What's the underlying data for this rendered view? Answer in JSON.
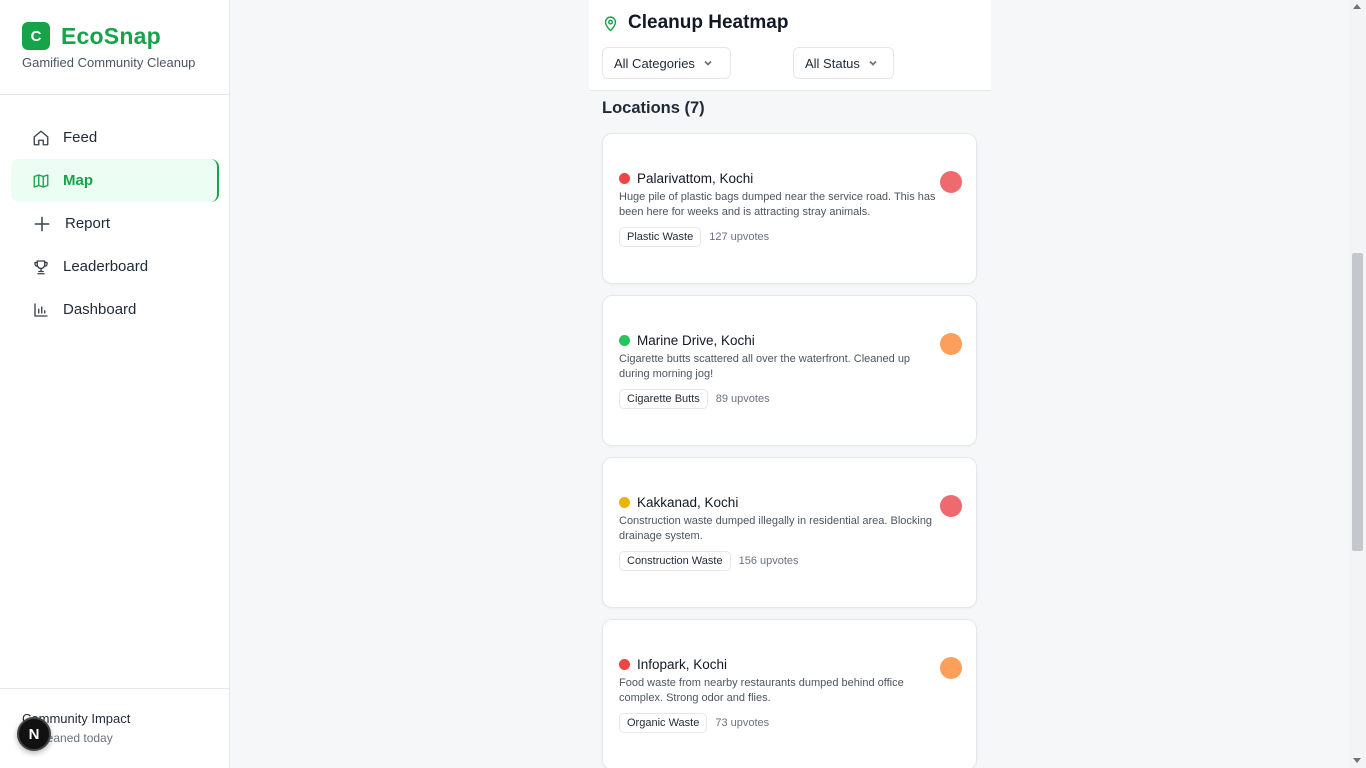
{
  "app": {
    "logo_letter": "C",
    "name": "EcoSnap",
    "tagline": "Gamified Community Cleanup"
  },
  "sidebar": {
    "items": [
      {
        "label": "Feed",
        "icon": "home-icon"
      },
      {
        "label": "Map",
        "icon": "map-icon",
        "active": true
      },
      {
        "label": "Report",
        "icon": "plus-icon"
      },
      {
        "label": "Leaderboard",
        "icon": "trophy-icon"
      },
      {
        "label": "Dashboard",
        "icon": "bar-chart-icon"
      }
    ],
    "impact_title": "Community Impact",
    "impact_sub": "as cleaned today",
    "badge_letter": "N"
  },
  "panel": {
    "title": "Cleanup Heatmap",
    "category_filter": "All Categories",
    "status_filter": "All Status",
    "locations_label": "Locations (7)"
  },
  "colors": {
    "brand": "#16a34a",
    "status_red": "#ef4444",
    "status_green": "#22c55e",
    "status_yellow": "#eab308",
    "severity_high": "#ee6a6f",
    "severity_medium": "#fb9f5a"
  },
  "locations": [
    {
      "name": "Palarivattom, Kochi",
      "description": "Huge pile of plastic bags dumped near the service road. This has been here for weeks and is attracting stray animals.",
      "category": "Plastic Waste",
      "upvotes": "127 upvotes",
      "status_color": "#ef4444",
      "severity_color": "#ee6a6f"
    },
    {
      "name": "Marine Drive, Kochi",
      "description": "Cigarette butts scattered all over the waterfront. Cleaned up during morning jog!",
      "category": "Cigarette Butts",
      "upvotes": "89 upvotes",
      "status_color": "#22c55e",
      "severity_color": "#fb9f5a"
    },
    {
      "name": "Kakkanad, Kochi",
      "description": "Construction waste dumped illegally in residential area. Blocking drainage system.",
      "category": "Construction Waste",
      "upvotes": "156 upvotes",
      "status_color": "#eab308",
      "severity_color": "#ee6a6f"
    },
    {
      "name": "Infopark, Kochi",
      "description": "Food waste from nearby restaurants dumped behind office complex. Strong odor and flies.",
      "category": "Organic Waste",
      "upvotes": "73 upvotes",
      "status_color": "#ef4444",
      "severity_color": "#fb9f5a"
    }
  ]
}
